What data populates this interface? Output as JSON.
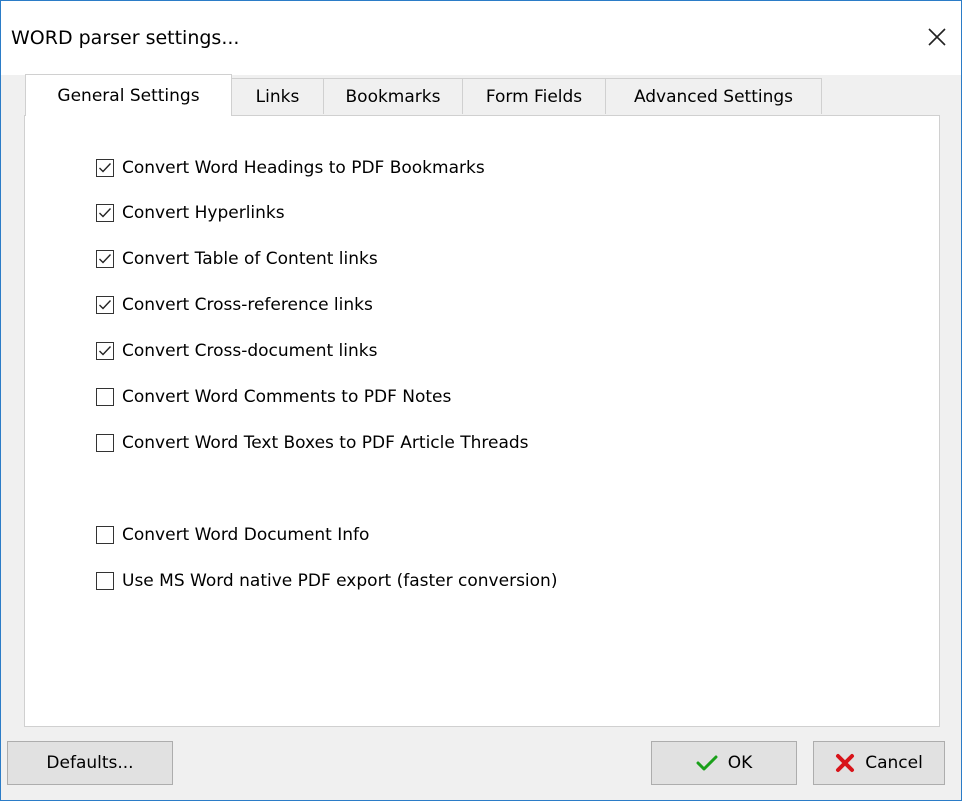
{
  "window": {
    "title": "WORD parser settings...",
    "close_icon": "close-icon"
  },
  "tabs": [
    {
      "label": "General Settings",
      "active": true
    },
    {
      "label": "Links",
      "active": false
    },
    {
      "label": "Bookmarks",
      "active": false
    },
    {
      "label": "Form Fields",
      "active": false
    },
    {
      "label": "Advanced Settings",
      "active": false
    }
  ],
  "options": [
    {
      "label": "Convert Word Headings to PDF Bookmarks",
      "checked": true
    },
    {
      "label": "Convert Hyperlinks",
      "checked": true
    },
    {
      "label": "Convert Table of Content links",
      "checked": true
    },
    {
      "label": "Convert Cross-reference links",
      "checked": true
    },
    {
      "label": "Convert Cross-document links",
      "checked": true
    },
    {
      "label": "Convert Word Comments to PDF Notes",
      "checked": false
    },
    {
      "label": "Convert Word Text Boxes to PDF Article Threads",
      "checked": false
    },
    {
      "label": "Convert Word Document Info",
      "checked": false
    },
    {
      "label": "Use MS Word native PDF export (faster conversion)",
      "checked": false
    }
  ],
  "buttons": {
    "defaults": "Defaults...",
    "ok": "OK",
    "cancel": "Cancel"
  },
  "colors": {
    "ok_check": "#1aa01a",
    "cancel_x": "#d8141a",
    "window_border": "#2b7cc7"
  }
}
